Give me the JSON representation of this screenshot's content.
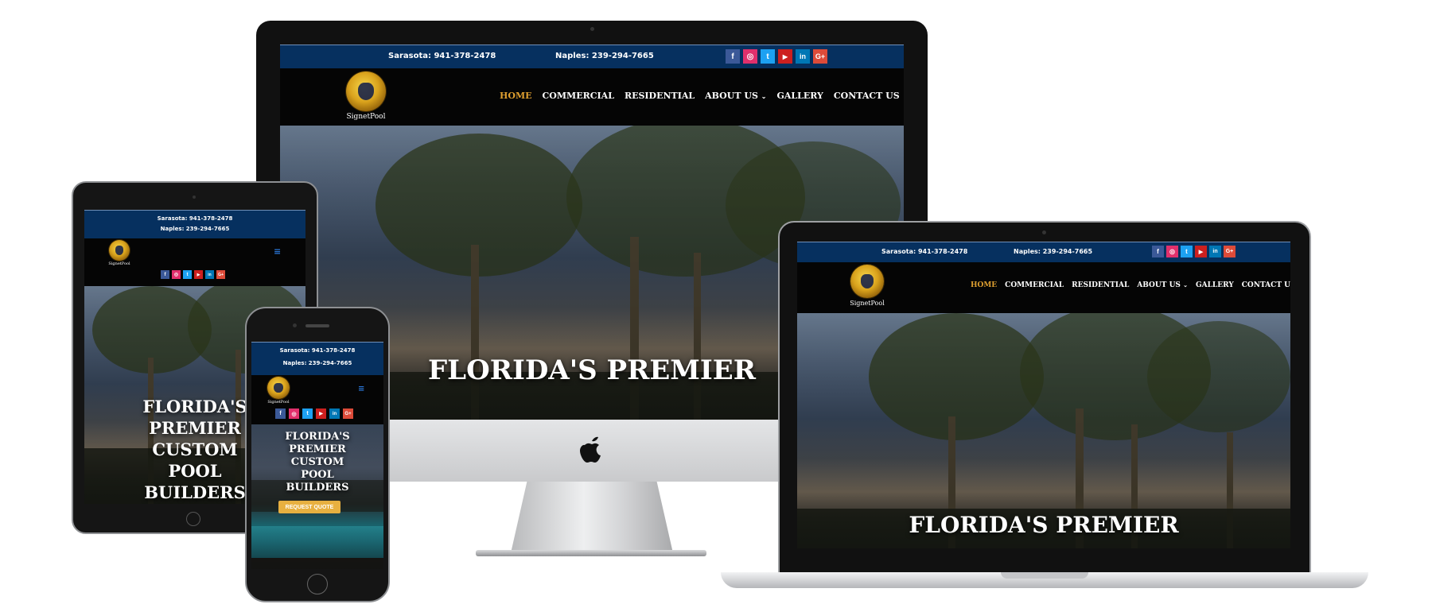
{
  "site": {
    "phone_sarasota": "Sarasota: 941-378-2478",
    "phone_naples": "Naples: 239-294-7665",
    "logo_text": "SignetPool",
    "nav": [
      "HOME",
      "COMMERCIAL",
      "RESIDENTIAL",
      "ABOUT US",
      "GALLERY",
      "CONTACT US"
    ],
    "nav_dropdown_marker": "⌄",
    "hero_title_short": "FLORIDA'S PREMIER",
    "hero_title_lines": [
      "FLORIDA'S",
      "PREMIER",
      "CUSTOM",
      "POOL",
      "BUILDERS"
    ],
    "cta": "REQUEST QUOTE",
    "social": [
      {
        "icon": "f",
        "name": "facebook",
        "color": "#3b5998"
      },
      {
        "icon": "◎",
        "name": "instagram",
        "color": "#e1306c"
      },
      {
        "icon": "t",
        "name": "twitter",
        "color": "#1da1f2"
      },
      {
        "icon": "▶",
        "name": "youtube",
        "color": "#cd201f"
      },
      {
        "icon": "in",
        "name": "linkedin",
        "color": "#0077b5"
      },
      {
        "icon": "G+",
        "name": "google-plus",
        "color": "#dd4b39"
      }
    ],
    "hamburger": "≡"
  },
  "colors": {
    "topbar": "#06305f",
    "active_nav": "#e0a030",
    "cta": "#e8b040"
  }
}
